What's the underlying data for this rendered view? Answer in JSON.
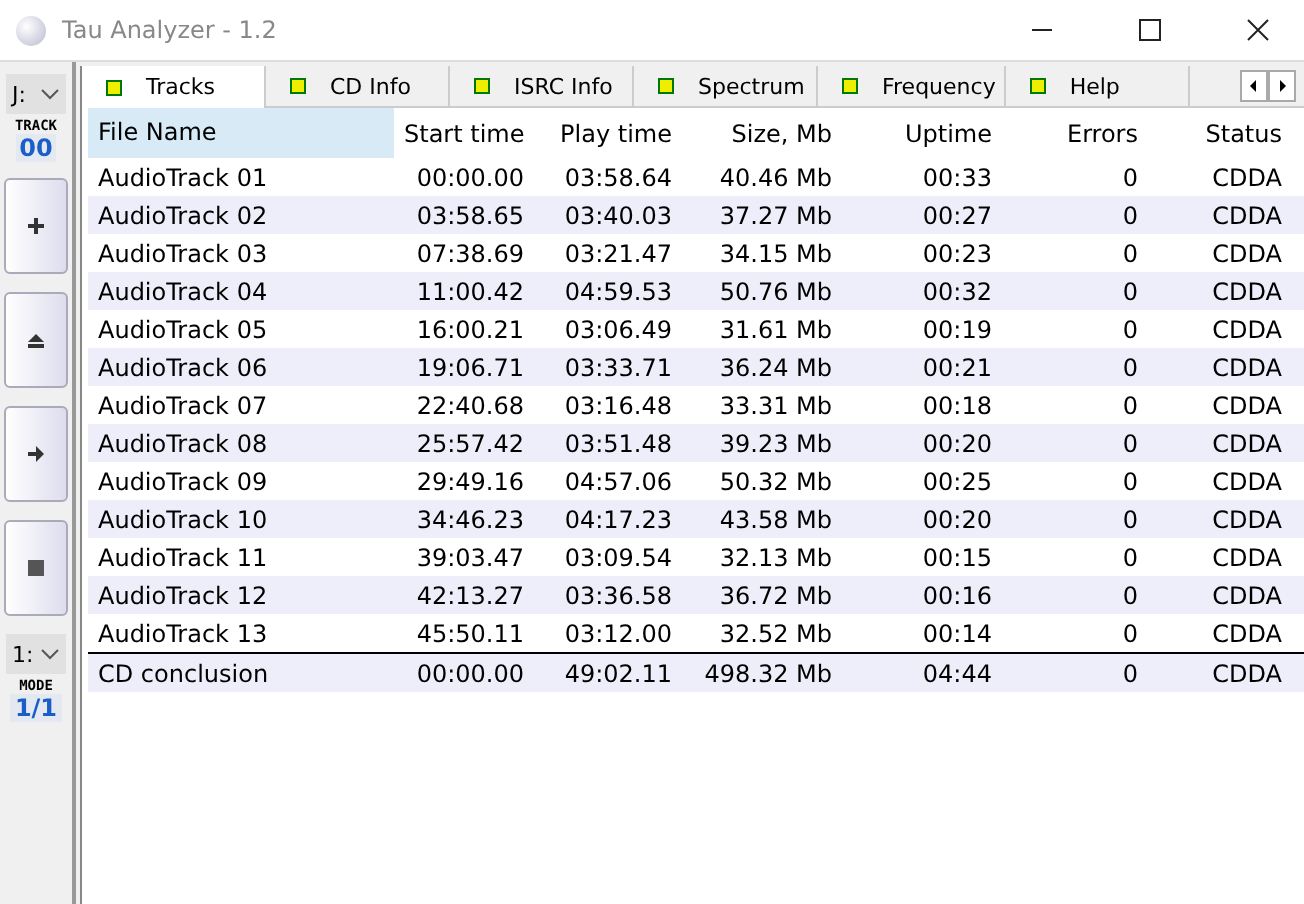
{
  "window": {
    "title": "Tau Analyzer - 1.2"
  },
  "side": {
    "drive": "J:",
    "track_label": "TRACK",
    "track": "00",
    "buttons": [
      {
        "kind": "plus"
      },
      {
        "kind": "eject"
      },
      {
        "kind": "next"
      },
      {
        "kind": "stop"
      }
    ],
    "mode_select": "1:",
    "mode_label": "MODE",
    "mode": "1/1"
  },
  "tabs": [
    {
      "label": "Tracks",
      "selected": true
    },
    {
      "label": "CD Info",
      "selected": false
    },
    {
      "label": "ISRC Info",
      "selected": false
    },
    {
      "label": "Spectrum",
      "selected": false
    },
    {
      "label": "Frequency",
      "selected": false
    },
    {
      "label": "Help",
      "selected": false
    }
  ],
  "table": {
    "columns": [
      "File Name",
      "Start time",
      "Play time",
      "Size, Mb",
      "Uptime",
      "Errors",
      "Status"
    ],
    "rows": [
      [
        "AudioTrack 01",
        "00:00.00",
        "03:58.64",
        "40.46 Mb",
        "00:33",
        "0",
        "CDDA"
      ],
      [
        "AudioTrack 02",
        "03:58.65",
        "03:40.03",
        "37.27 Mb",
        "00:27",
        "0",
        "CDDA"
      ],
      [
        "AudioTrack 03",
        "07:38.69",
        "03:21.47",
        "34.15 Mb",
        "00:23",
        "0",
        "CDDA"
      ],
      [
        "AudioTrack 04",
        "11:00.42",
        "04:59.53",
        "50.76 Mb",
        "00:32",
        "0",
        "CDDA"
      ],
      [
        "AudioTrack 05",
        "16:00.21",
        "03:06.49",
        "31.61 Mb",
        "00:19",
        "0",
        "CDDA"
      ],
      [
        "AudioTrack 06",
        "19:06.71",
        "03:33.71",
        "36.24 Mb",
        "00:21",
        "0",
        "CDDA"
      ],
      [
        "AudioTrack 07",
        "22:40.68",
        "03:16.48",
        "33.31 Mb",
        "00:18",
        "0",
        "CDDA"
      ],
      [
        "AudioTrack 08",
        "25:57.42",
        "03:51.48",
        "39.23 Mb",
        "00:20",
        "0",
        "CDDA"
      ],
      [
        "AudioTrack 09",
        "29:49.16",
        "04:57.06",
        "50.32 Mb",
        "00:25",
        "0",
        "CDDA"
      ],
      [
        "AudioTrack 10",
        "34:46.23",
        "04:17.23",
        "43.58 Mb",
        "00:20",
        "0",
        "CDDA"
      ],
      [
        "AudioTrack 11",
        "39:03.47",
        "03:09.54",
        "32.13 Mb",
        "00:15",
        "0",
        "CDDA"
      ],
      [
        "AudioTrack 12",
        "42:13.27",
        "03:36.58",
        "36.72 Mb",
        "00:16",
        "0",
        "CDDA"
      ],
      [
        "AudioTrack 13",
        "45:50.11",
        "03:12.00",
        "32.52 Mb",
        "00:14",
        "0",
        "CDDA"
      ]
    ],
    "summary": [
      "CD conclusion",
      "00:00.00",
      "49:02.11",
      "498.32 Mb",
      "04:44",
      "0",
      "CDDA"
    ]
  }
}
